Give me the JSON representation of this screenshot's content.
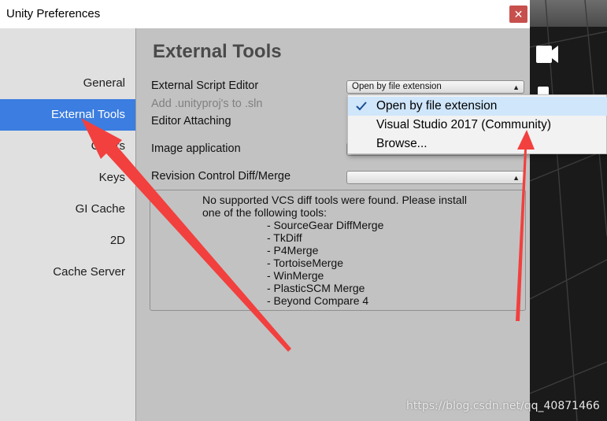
{
  "window": {
    "title": "Unity Preferences",
    "close_glyph": "✕"
  },
  "sidebar": {
    "items": [
      {
        "label": "General"
      },
      {
        "label": "External Tools",
        "active": true
      },
      {
        "label": "Colors"
      },
      {
        "label": "Keys"
      },
      {
        "label": "GI Cache"
      },
      {
        "label": "2D"
      },
      {
        "label": "Cache Server"
      }
    ]
  },
  "content": {
    "heading": "External Tools",
    "external_script_editor_label": "External Script Editor",
    "external_script_editor_value": "Open by file extension",
    "add_unityproj_label": "Add .unityproj's to .sln",
    "editor_attaching_label": "Editor Attaching",
    "image_application_label": "Image application",
    "revision_control_label": "Revision Control Diff/Merge",
    "revision_control_value": "",
    "vcs_message": [
      "No supported VCS diff tools were found. Please install",
      "one of the following tools:",
      "- SourceGear DiffMerge",
      "- TkDiff",
      "- P4Merge",
      "- TortoiseMerge",
      "- WinMerge",
      "- PlasticSCM Merge",
      "- Beyond Compare 4"
    ]
  },
  "menu": {
    "items": [
      {
        "label": "Open by file extension",
        "checked": true
      },
      {
        "label": "Visual Studio 2017 (Community)",
        "checked": false
      },
      {
        "label": "Browse...",
        "checked": false
      }
    ]
  },
  "colors": {
    "accent": "#3b7de0",
    "arrow": "#f2403e",
    "close": "#c7504d"
  },
  "watermark": "https://blog.csdn.net/qq_40871466"
}
